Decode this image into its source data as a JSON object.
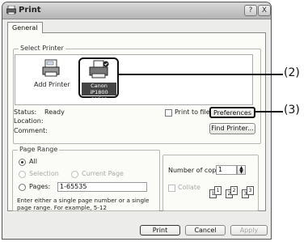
{
  "window": {
    "title": "Print",
    "help_glyph": "?",
    "close_glyph": "X"
  },
  "tabs": [
    {
      "label": "General"
    }
  ],
  "select_printer": {
    "legend": "Select Printer",
    "printers": [
      {
        "label": "Add Printer"
      },
      {
        "label_line1": "Canon iP1800",
        "label_line2": "series"
      }
    ]
  },
  "status": {
    "status_label": "Status:",
    "status_value": "Ready",
    "location_label": "Location:",
    "comment_label": "Comment:"
  },
  "print_to_file": {
    "label": "Print to file"
  },
  "buttons": {
    "preferences": "Preferences",
    "find_printer": "Find Printer...",
    "print": "Print",
    "cancel": "Cancel",
    "apply": "Apply"
  },
  "page_range": {
    "legend": "Page Range",
    "all": "All",
    "selection": "Selection",
    "current_page": "Current Page",
    "pages": "Pages:",
    "pages_value": "1-65535",
    "hint_line1": "Enter either a single page number or a single",
    "hint_line2": "page range.  For example, 5-12"
  },
  "copies": {
    "label": "Number of copies:",
    "value": "1",
    "collate_label": "Collate",
    "collate_pages": [
      "1",
      "1",
      "2",
      "2",
      "3",
      "3"
    ]
  },
  "callouts": {
    "c2": "(2)",
    "c3": "(3)"
  }
}
